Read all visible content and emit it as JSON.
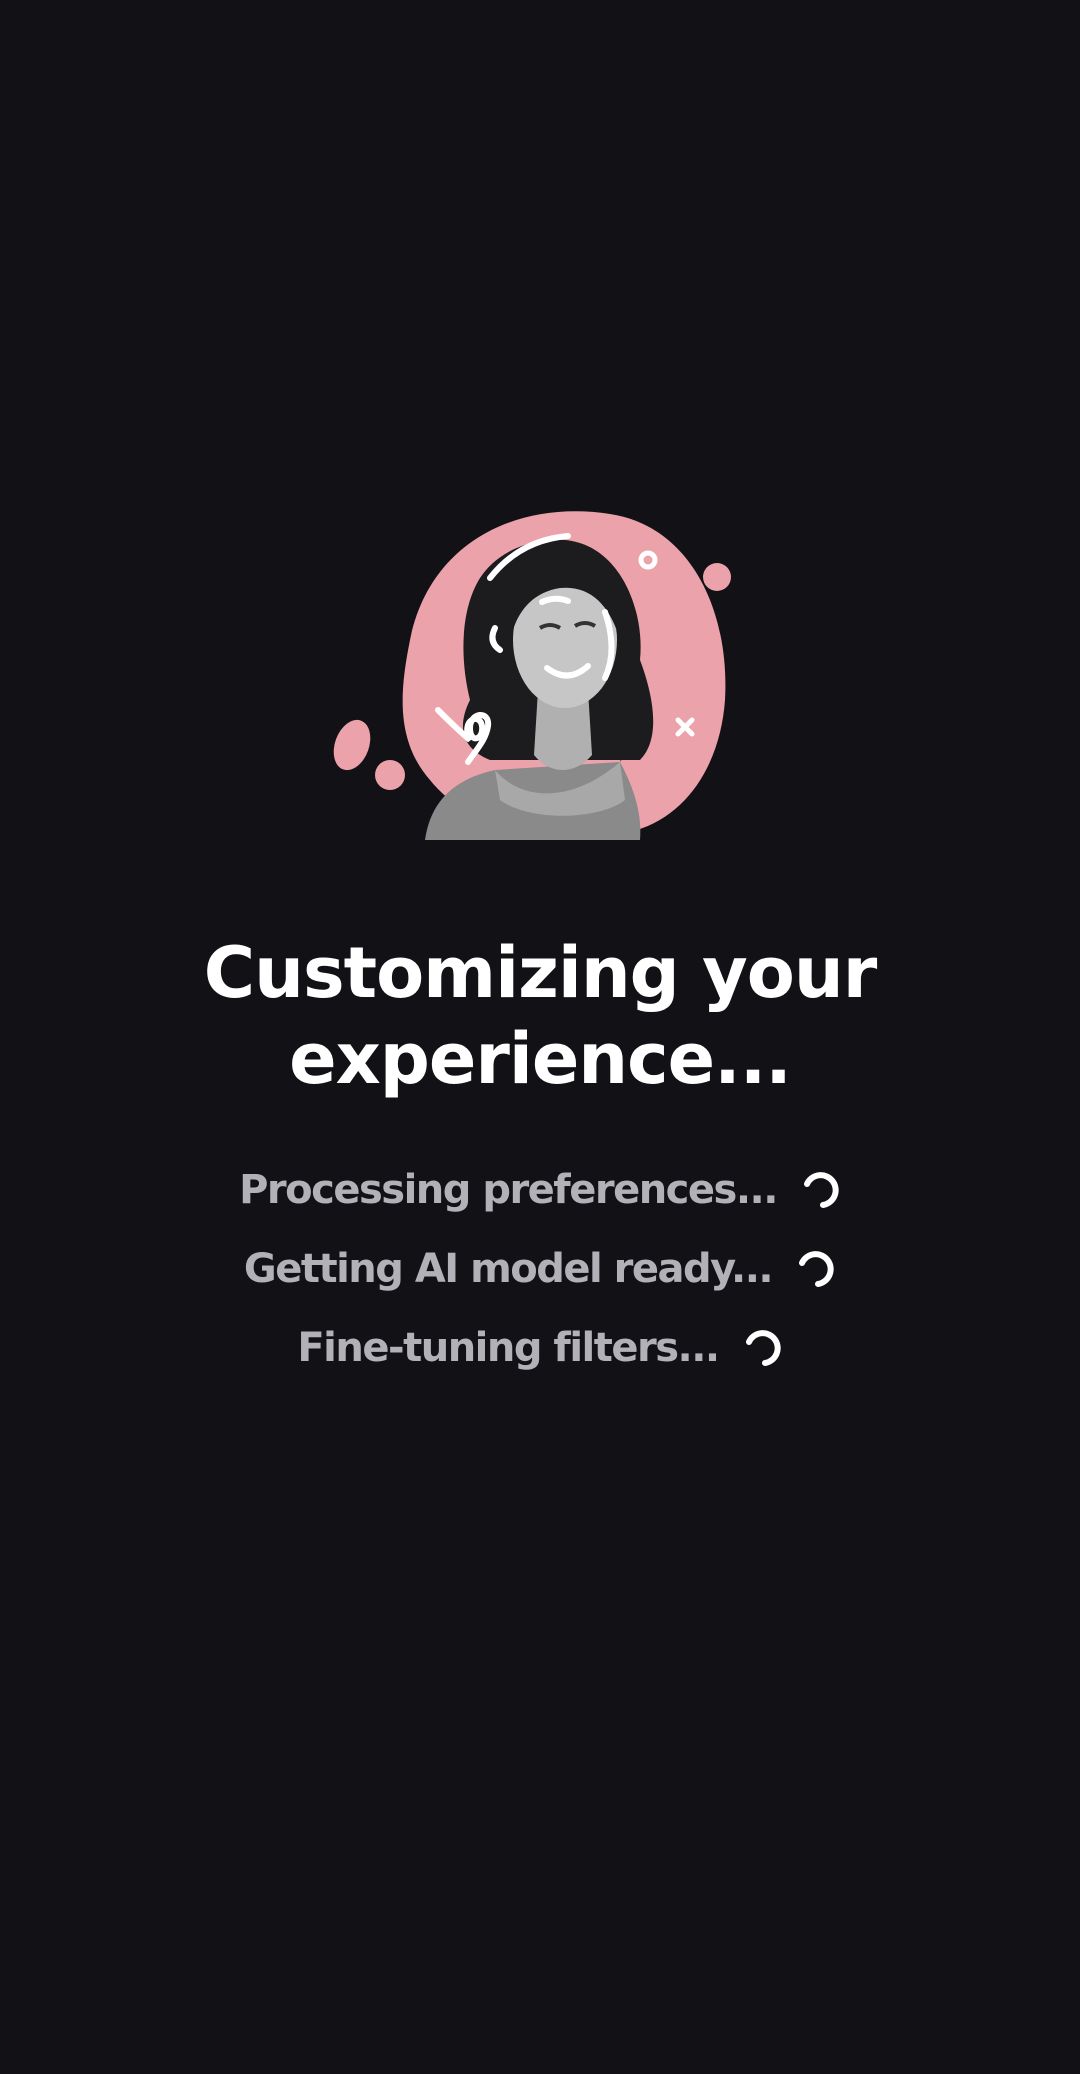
{
  "title": "Customizing your experience...",
  "statuses": [
    {
      "label": "Processing preferences...",
      "icon": "spinner-icon"
    },
    {
      "label": "Getting AI model ready...",
      "icon": "spinner-icon"
    },
    {
      "label": "Fine-tuning filters...",
      "icon": "spinner-icon"
    }
  ],
  "colors": {
    "background": "#121116",
    "blob": "#eba2ab",
    "title": "#ffffff",
    "status_text": "#b3b1b8"
  }
}
